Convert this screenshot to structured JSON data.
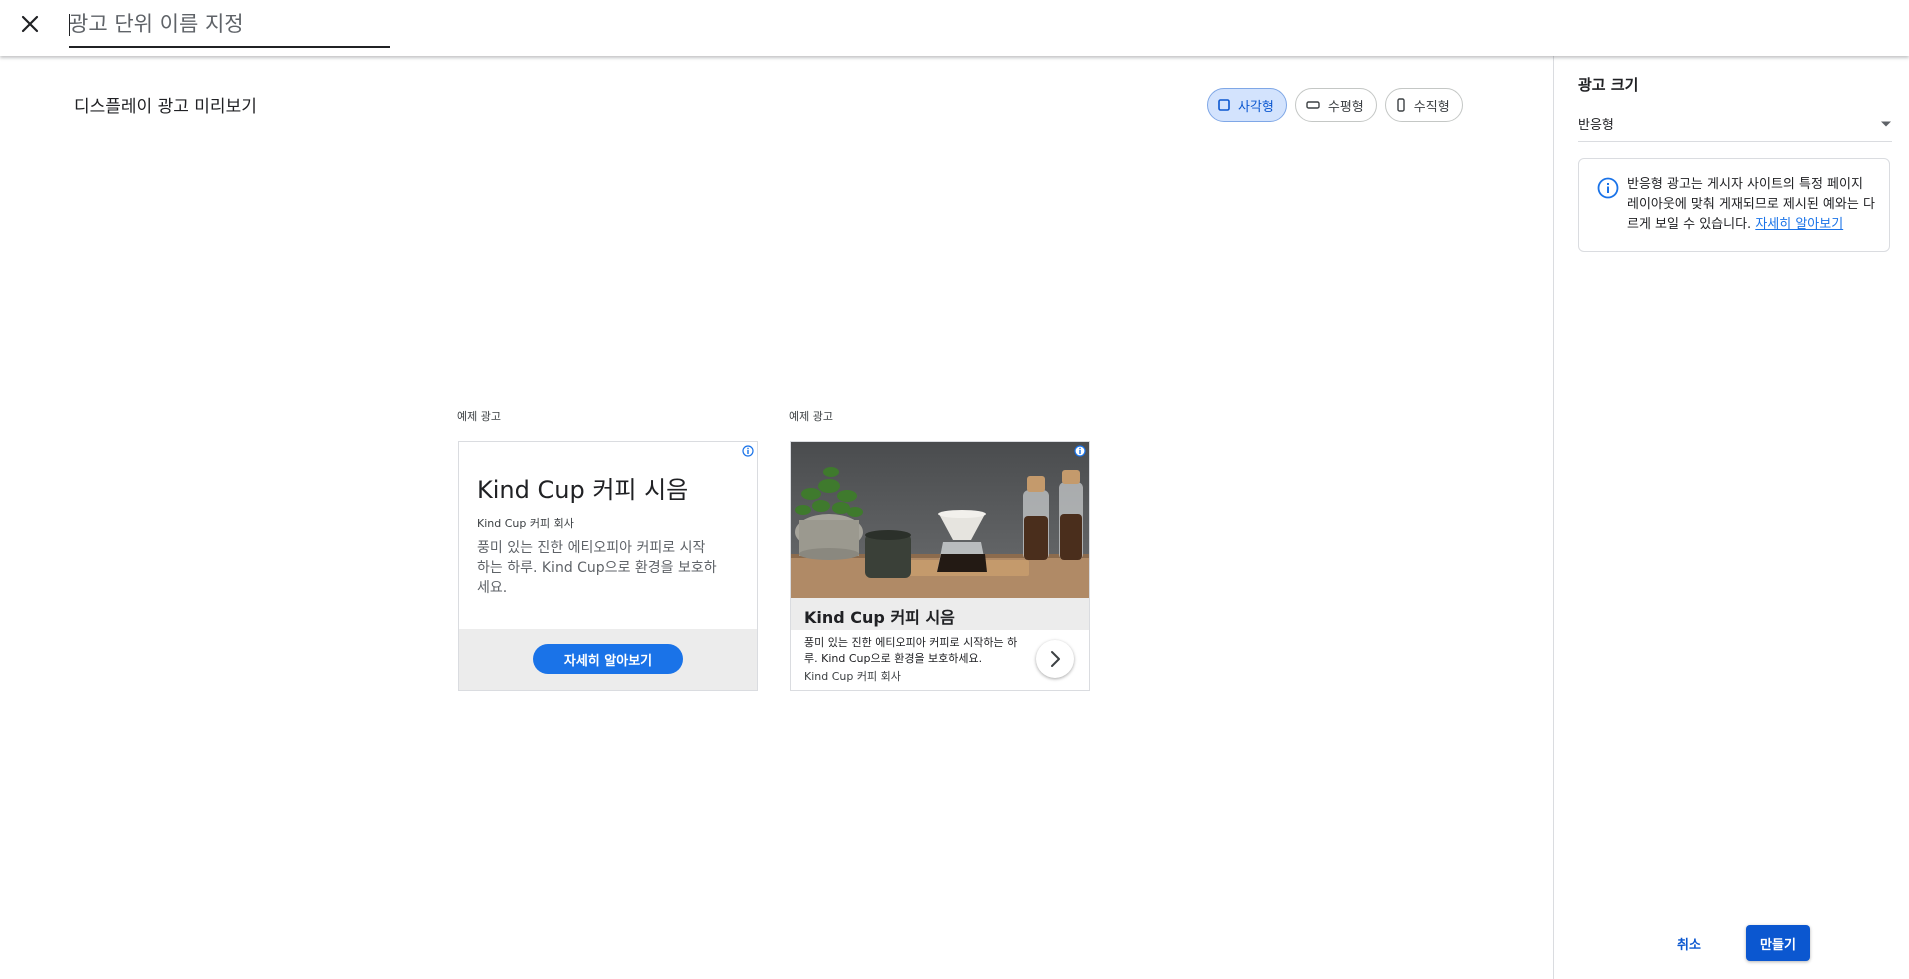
{
  "header": {
    "close_icon": "close-icon",
    "name_input_placeholder": "광고 단위 이름 지정",
    "name_input_value": ""
  },
  "preview": {
    "title": "디스플레이 광고 미리보기",
    "shapes": [
      {
        "label": "사각형",
        "icon": "square-icon",
        "selected": true
      },
      {
        "label": "수평형",
        "icon": "horizontal-rect-icon",
        "selected": false
      },
      {
        "label": "수직형",
        "icon": "vertical-rect-icon",
        "selected": false
      }
    ],
    "ads": [
      {
        "label": "예제 광고",
        "title": "Kind Cup 커피 시음",
        "company": "Kind Cup 커피 회사",
        "description": "풍미 있는 진한 에티오피아 커피로 시작하는 하루. Kind Cup으로 환경을 보호하세요.",
        "cta": "자세히 알아보기"
      },
      {
        "label": "예제 광고",
        "title": "Kind Cup 커피 시음",
        "description": "풍미 있는 진한 에티오피아 커피로 시작하는 하루. Kind Cup으로 환경을 보호하세요.",
        "company": "Kind Cup 커피 회사",
        "image": "coffee-photo"
      }
    ]
  },
  "sidebar": {
    "title": "광고 크기",
    "size_select": "반응형",
    "info_text": "반응형 광고는 게시자 사이트의 특정 페이지 레이아웃에 맞춰 게재되므로 제시된 예와는 다르게 보일 수 있습니다.",
    "info_link": "자세히 알아보기",
    "cancel": "취소",
    "create": "만들기"
  },
  "colors": {
    "accent": "#0b57d0",
    "cta_blue": "#1a73e8",
    "chip_selected_bg": "#d3e3fd"
  }
}
